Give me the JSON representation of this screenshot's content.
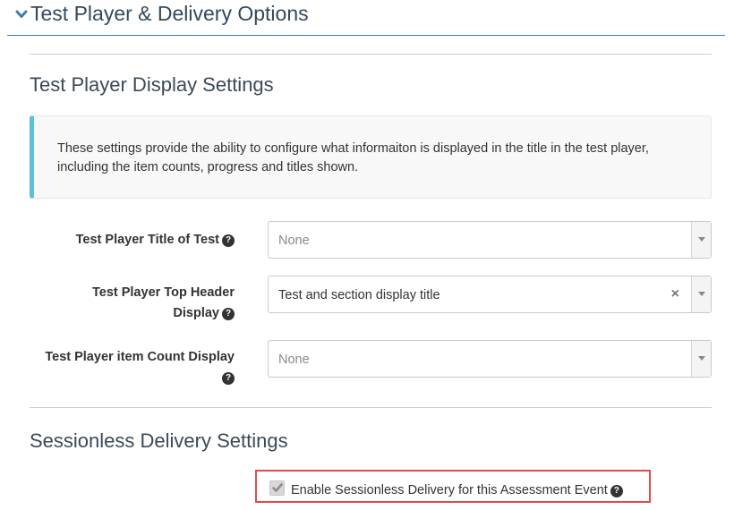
{
  "section": {
    "title": "Test Player & Delivery Options",
    "icon": "chevron-down-icon"
  },
  "display_settings": {
    "heading": "Test Player Display Settings",
    "info_text": "These settings provide the ability to configure what informaiton is displayed in the title in the test player, including the item counts, progress and titles shown.",
    "fields": [
      {
        "label_line1": "Test Player Title of Test",
        "label_line2": "",
        "value": "None",
        "is_placeholder": true,
        "clearable": false
      },
      {
        "label_line1": "Test Player Top Header",
        "label_line2": "Display",
        "value": "Test and section display title",
        "is_placeholder": false,
        "clearable": true
      },
      {
        "label_line1": "Test Player item Count Display",
        "label_line2": "",
        "value": "None",
        "is_placeholder": true,
        "clearable": false
      }
    ]
  },
  "sessionless": {
    "heading": "Sessionless Delivery Settings",
    "checkbox_label": "Enable Sessionless Delivery for this Assessment Event",
    "checked": true
  },
  "colors": {
    "header_rule": "#3d7fb3",
    "info_accent": "#5bc0de",
    "highlight_border": "#e04b4b"
  }
}
